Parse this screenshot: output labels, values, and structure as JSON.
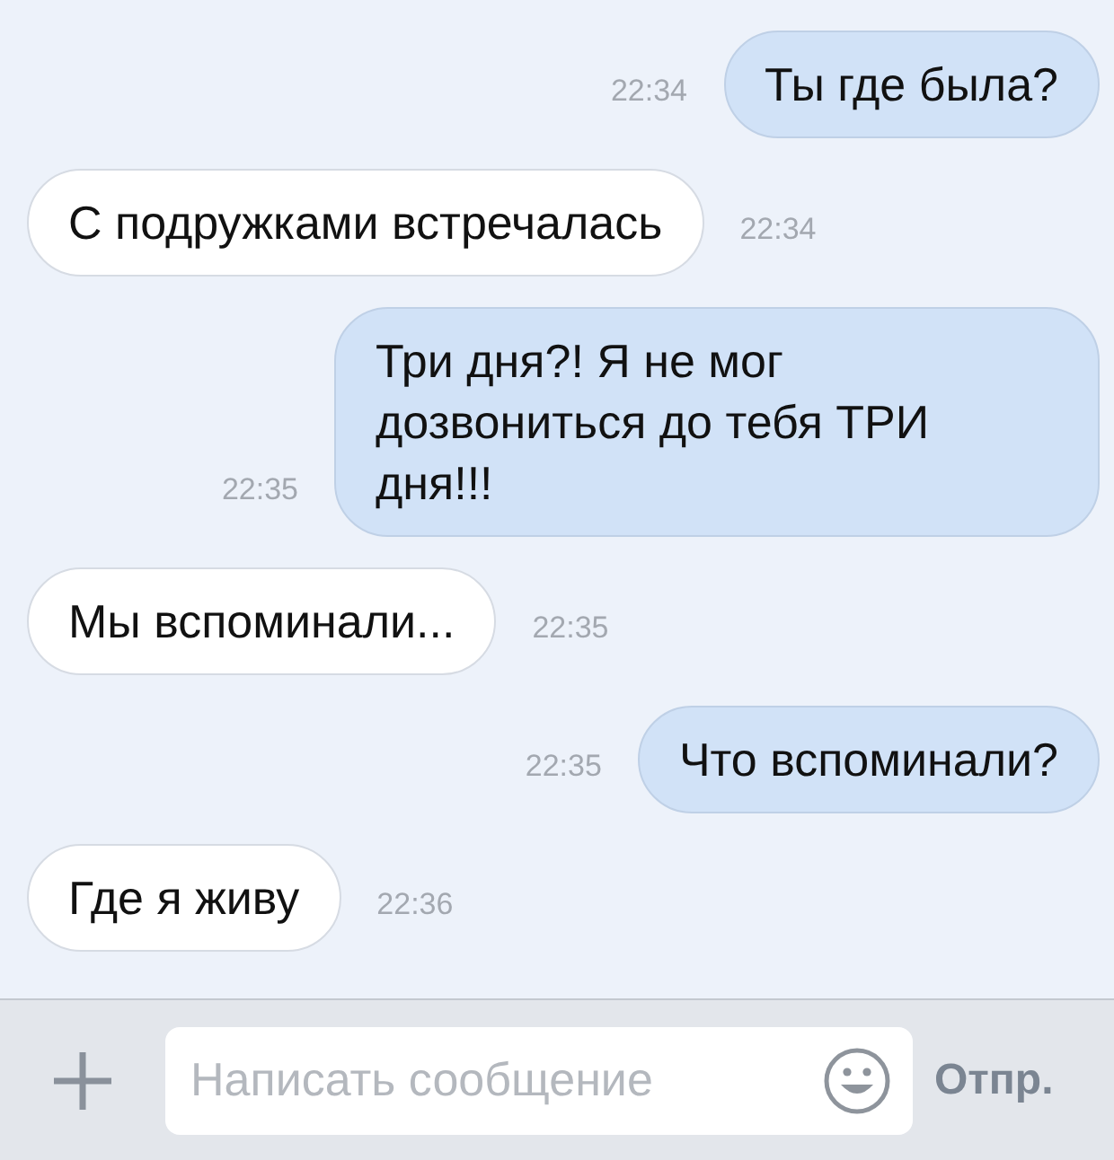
{
  "messages": [
    {
      "kind": "sent",
      "text": "Ты где была?",
      "time": "22:34"
    },
    {
      "kind": "received",
      "text": "С подружками встречалась",
      "time": "22:34"
    },
    {
      "kind": "sent",
      "text": "Три дня?! Я не мог дозвониться до тебя ТРИ дня!!!",
      "time": "22:35"
    },
    {
      "kind": "received",
      "text": "Мы вспоминали...",
      "time": "22:35"
    },
    {
      "kind": "sent",
      "text": "Что вспоминали?",
      "time": "22:35"
    },
    {
      "kind": "received",
      "text": "Где я живу",
      "time": "22:36"
    }
  ],
  "composer": {
    "placeholder": "Написать сообщение",
    "send_label": "Отпр."
  }
}
